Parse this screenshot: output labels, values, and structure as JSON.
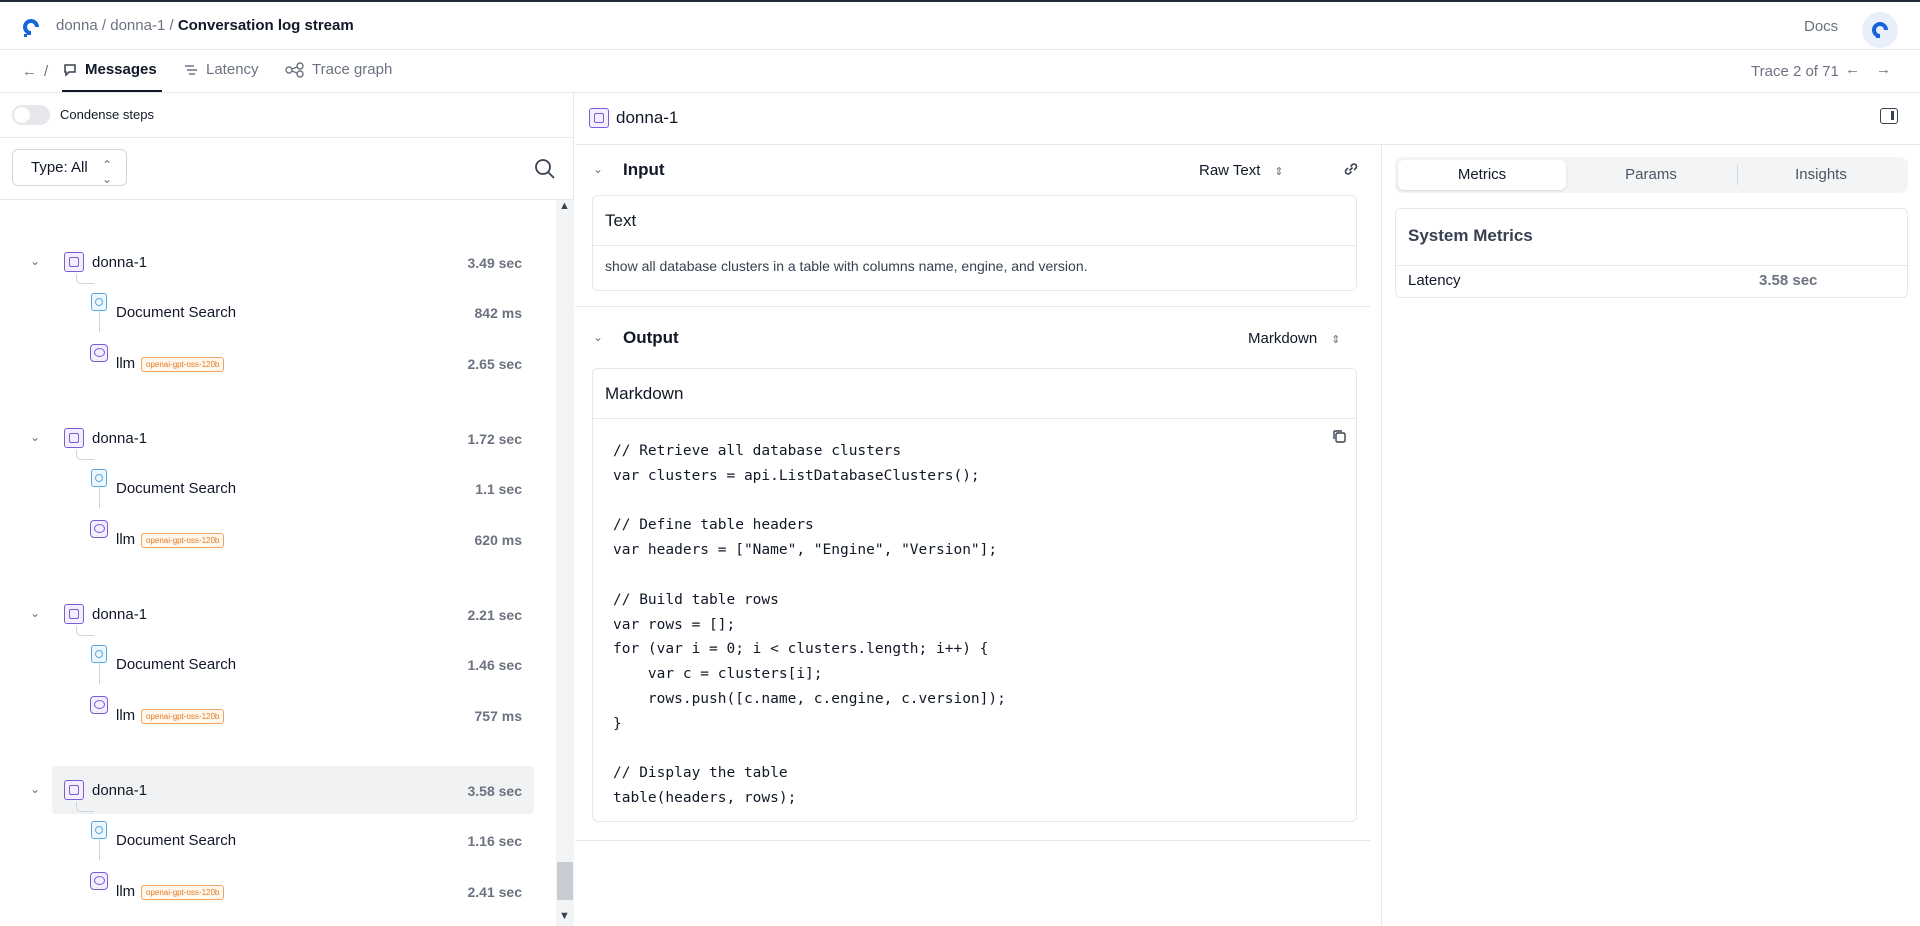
{
  "header": {
    "crumbs": [
      "donna",
      " / ",
      "donna-1",
      " / "
    ],
    "current": "Conversation log stream",
    "docs": "Docs"
  },
  "tabs": {
    "back_sep": "/",
    "items": [
      {
        "label": "Messages",
        "active": true,
        "icon": "message-icon"
      },
      {
        "label": "Latency",
        "active": false,
        "icon": "latency-icon"
      },
      {
        "label": "Trace graph",
        "active": false,
        "icon": "trace-graph-icon"
      }
    ],
    "trace": "Trace 2 of 71"
  },
  "left": {
    "condense_label": "Condense steps",
    "type_filter": "Type: All",
    "groups": [
      {
        "name": "donna-1",
        "duration": "3.49 sec",
        "selected": false,
        "children": [
          {
            "name": "Document Search",
            "duration": "842 ms",
            "kind": "doc"
          },
          {
            "name": "llm",
            "duration": "2.65 sec",
            "kind": "llm",
            "badge": "openai-gpt-oss-120b"
          }
        ]
      },
      {
        "name": "donna-1",
        "duration": "1.72 sec",
        "selected": false,
        "children": [
          {
            "name": "Document Search",
            "duration": "1.1 sec",
            "kind": "doc"
          },
          {
            "name": "llm",
            "duration": "620 ms",
            "kind": "llm",
            "badge": "openai-gpt-oss-120b"
          }
        ]
      },
      {
        "name": "donna-1",
        "duration": "2.21 sec",
        "selected": false,
        "children": [
          {
            "name": "Document Search",
            "duration": "1.46 sec",
            "kind": "doc"
          },
          {
            "name": "llm",
            "duration": "757 ms",
            "kind": "llm",
            "badge": "openai-gpt-oss-120b"
          }
        ]
      },
      {
        "name": "donna-1",
        "duration": "3.58 sec",
        "selected": true,
        "children": [
          {
            "name": "Document Search",
            "duration": "1.16 sec",
            "kind": "doc"
          },
          {
            "name": "llm",
            "duration": "2.41 sec",
            "kind": "llm",
            "badge": "openai-gpt-oss-120b"
          }
        ]
      }
    ]
  },
  "detail": {
    "title": "donna-1",
    "input": {
      "label": "Input",
      "format": "Raw Text",
      "card_title": "Text",
      "text": "show all database clusters in a table with columns name, engine, and version."
    },
    "output": {
      "label": "Output",
      "format": "Markdown",
      "card_title": "Markdown",
      "code": "// Retrieve all database clusters\nvar clusters = api.ListDatabaseClusters();\n\n// Define table headers\nvar headers = [\"Name\", \"Engine\", \"Version\"];\n\n// Build table rows\nvar rows = [];\nfor (var i = 0; i < clusters.length; i++) {\n    var c = clusters[i];\n    rows.push([c.name, c.engine, c.version]);\n}\n\n// Display the table\ntable(headers, rows);"
    }
  },
  "metrics": {
    "tabs": [
      "Metrics",
      "Params",
      "Insights"
    ],
    "active_tab": "Metrics",
    "card_title": "System Metrics",
    "rows": [
      {
        "key": "Latency",
        "value": "3.58 sec"
      }
    ]
  }
}
